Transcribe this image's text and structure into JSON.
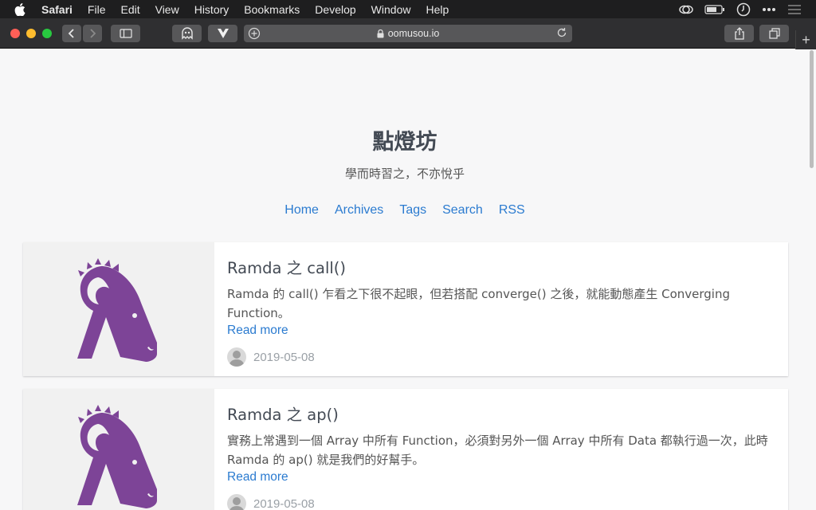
{
  "menubar": {
    "app_name": "Safari",
    "items": [
      "File",
      "Edit",
      "View",
      "History",
      "Bookmarks",
      "Develop",
      "Window",
      "Help"
    ]
  },
  "toolbar": {
    "url": "oomusou.io",
    "new_tab": "+"
  },
  "site": {
    "title": "點燈坊",
    "subtitle": "學而時習之，不亦悅乎",
    "nav": [
      "Home",
      "Archives",
      "Tags",
      "Search",
      "RSS"
    ]
  },
  "posts": [
    {
      "title": "Ramda 之 call()",
      "excerpt": "Ramda 的 call() 乍看之下很不起眼，但若搭配 converge() 之後，就能動態產生 Converging Function。",
      "read_more": "Read more",
      "date": "2019-05-08"
    },
    {
      "title": "Ramda 之 ap()",
      "excerpt": "實務上常遇到一個 Array 中所有 Function，必須對另外一個 Array 中所有 Data 都執行過一次，此時 Ramda 的 ap() 就是我們的好幫手。",
      "read_more": "Read more",
      "date": "2019-05-08"
    }
  ],
  "colors": {
    "link": "#2b7bd0",
    "logo": "#7d4497",
    "menubar_bg": "#1e1e1f",
    "toolbar_bg": "#2f2f31"
  },
  "icons": [
    "apple-icon",
    "wifi-icon",
    "battery-icon",
    "clock-icon",
    "more-icon",
    "list-icon",
    "back-icon",
    "forward-icon",
    "sidebar-icon",
    "ghostery-icon",
    "vue-devtools-icon",
    "lock-icon",
    "reload-icon",
    "share-icon",
    "tabs-icon",
    "ramda-logo-icon"
  ]
}
